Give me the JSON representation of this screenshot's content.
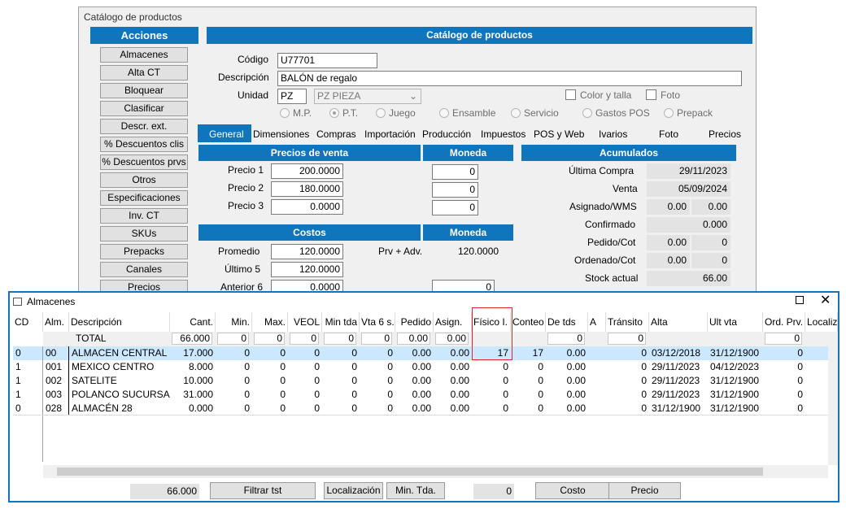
{
  "bg_window": {
    "title": "Catálogo de productos",
    "actions_header": "Acciones",
    "actions": [
      "Almacenes",
      "Alta CT",
      "Bloquear",
      "Clasificar",
      "Descr. ext.",
      "% Descuentos clis",
      "% Descuentos prvs",
      "Otros",
      "Especificaciones",
      "Inv. CT",
      "SKUs",
      "Prepacks",
      "Canales",
      "Precios"
    ],
    "main_header": "Catálogo de productos",
    "codigo_label": "Código",
    "codigo_value": "U77701",
    "descripcion_label": "Descripción",
    "descripcion_value": "BALÓN de regalo",
    "unidad_label": "Unidad",
    "unidad_value": "PZ",
    "unidad_select": "PZ  PIEZA",
    "color_talla": "Color y talla",
    "foto_chk": "Foto",
    "radios": [
      "M.P.",
      "P.T.",
      "Juego",
      "Ensamble",
      "Servicio",
      "Gastos POS",
      "Prepack"
    ],
    "tabs": [
      "General",
      "Dimensiones",
      "Compras",
      "Importación",
      "Producción",
      "Impuestos",
      "POS y Web",
      "Ivarios",
      "Foto",
      "Precios"
    ],
    "precios_header": "Precios de venta",
    "moneda_header": "Moneda",
    "acumulados_header": "Acumulados",
    "precio_labels": [
      "Precio 1",
      "Precio 2",
      "Precio 3"
    ],
    "precio_values": [
      "200.0000",
      "180.0000",
      "0.0000"
    ],
    "moneda_values": [
      "0",
      "0",
      "0"
    ],
    "costos_header": "Costos",
    "moneda2_header": "Moneda",
    "promedio_label": "Promedio",
    "promedio_value": "120.0000",
    "prv_adv_label": "Prv + Adv.",
    "prv_adv_value": "120.0000",
    "ultimo5_label": "Último 5",
    "ultimo5_value": "120.0000",
    "anterior6_label": "Anterior 6",
    "anterior6_value": "0.0000",
    "anterior6_moneda": "0",
    "acum": {
      "ultima_compra_label": "Última  Compra",
      "ultima_compra": "29/11/2023",
      "venta_label": "Venta",
      "venta": "05/09/2024",
      "asignado_label": "Asignado/WMS",
      "asignado_a": "0.00",
      "asignado_b": "0.00",
      "confirmado_label": "Confirmado",
      "confirmado": "0.000",
      "pedido_label": "Pedido/Cot",
      "pedido_a": "0.00",
      "pedido_b": "0",
      "ordenado_label": "Ordenado/Cot",
      "ordenado_a": "0.00",
      "ordenado_b": "0",
      "stock_label": "Stock actual",
      "stock": "66.00"
    }
  },
  "almacenes": {
    "title": "Almacenes",
    "columns": [
      "CD",
      "Alm.",
      "Descripción",
      "Cant.",
      "Min.",
      "Max.",
      "VEOL",
      "Min tda",
      "Vta 6 s.",
      "Pedido",
      "Asign.",
      "Físico I.",
      "Conteo",
      "De tds",
      "A",
      "Tránsito",
      "Alta",
      "Ult vta",
      "Ord. Prv.",
      "Localiza"
    ],
    "total_label": "TOTAL",
    "totals": [
      "66.000",
      "0",
      "0",
      "0",
      "0",
      "0",
      "0.00",
      "0.00",
      "",
      "",
      "0",
      "",
      "0",
      "",
      "",
      "0"
    ],
    "rows": [
      [
        "0",
        "00",
        "ALMACEN CENTRAL",
        "17.000",
        "0",
        "0",
        "0",
        "0",
        "0",
        "0.00",
        "0.00",
        "17",
        "17",
        "0.00",
        "",
        "0",
        "03/12/2018",
        "31/12/1900",
        "0"
      ],
      [
        "1",
        "001",
        "MEXICO CENTRO",
        "8.000",
        "0",
        "0",
        "0",
        "0",
        "0",
        "0.00",
        "0.00",
        "0",
        "0",
        "0.00",
        "",
        "0",
        "29/11/2023",
        "04/12/2023",
        "0"
      ],
      [
        "1",
        "002",
        "SATELITE",
        "10.000",
        "0",
        "0",
        "0",
        "0",
        "0",
        "0.00",
        "0.00",
        "0",
        "0",
        "0.00",
        "",
        "0",
        "29/11/2023",
        "31/12/1900",
        "0"
      ],
      [
        "1",
        "003",
        "POLANCO SUCURSAL",
        "31.000",
        "0",
        "0",
        "0",
        "0",
        "0",
        "0.00",
        "0.00",
        "0",
        "0",
        "0.00",
        "",
        "0",
        "29/11/2023",
        "31/12/1900",
        "0"
      ],
      [
        "0",
        "028",
        "ALMACÉN 28",
        "0.000",
        "0",
        "0",
        "0",
        "0",
        "0",
        "0.00",
        "0.00",
        "0",
        "0",
        "0.00",
        "",
        "0",
        "31/12/1900",
        "31/12/1900",
        "0"
      ]
    ],
    "footer_total": "66.000",
    "filtrar_btn": "Filtrar  tst",
    "localizacion_btn": "Localización",
    "min_tda_btn": "Min. Tda.",
    "footer_zero": "0",
    "costo_btn": "Costo",
    "precio_btn": "Precio",
    "colors": {
      "accent": "#0f75bd",
      "selected_row": "#cce8ff",
      "highlight_border": "#d9262c"
    }
  }
}
